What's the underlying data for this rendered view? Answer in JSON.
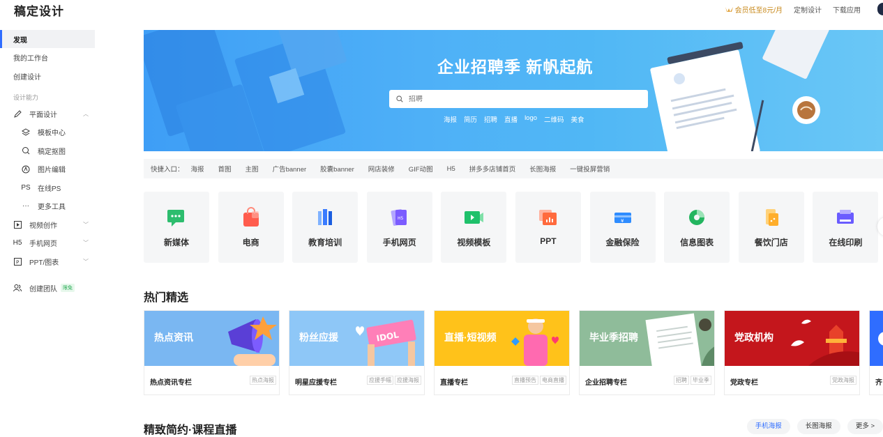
{
  "header": {
    "logo": "稿定设计",
    "vip": "会员低至8元/月",
    "custom_design": "定制设计",
    "download_app": "下载应用"
  },
  "sidebar": {
    "top": [
      {
        "label": "发现",
        "active": true
      },
      {
        "label": "我的工作台"
      },
      {
        "label": "创建设计"
      }
    ],
    "section_label": "设计能力",
    "graphic": "平面设计",
    "graphic_sub": [
      {
        "label": "模板中心",
        "icon": "layers-icon"
      },
      {
        "label": "稿定抠图",
        "icon": "cutout-icon"
      },
      {
        "label": "图片编辑",
        "icon": "image-edit-icon"
      },
      {
        "label": "在线PS",
        "icon": "ps-icon",
        "glyph": "PS"
      },
      {
        "label": "更多工具",
        "icon": "more-icon",
        "glyph": "···"
      }
    ],
    "video": "视频创作",
    "h5": "手机网页",
    "h5_glyph": "H5",
    "ppt": "PPT/图表",
    "team": "创建团队",
    "team_badge": "限免"
  },
  "banner": {
    "title": "企业招聘季 新帆起航",
    "search_placeholder": "招聘",
    "tags": [
      "海报",
      "简历",
      "招聘",
      "直播",
      "logo",
      "二维码",
      "美食"
    ]
  },
  "quick": {
    "label": "快捷入口：",
    "items": [
      "海报",
      "首图",
      "主图",
      "广告banner",
      "胶囊banner",
      "网店装修",
      "GIF动图",
      "H5",
      "拼多多店铺首页",
      "长图海报",
      "一键投屏营销"
    ]
  },
  "categories": [
    {
      "label": "新媒体",
      "color": "#2dbd6e"
    },
    {
      "label": "电商",
      "color": "#ff5c4d"
    },
    {
      "label": "教育培训",
      "color": "#3a7bff"
    },
    {
      "label": "手机网页",
      "color": "#7b5cff"
    },
    {
      "label": "视频模板",
      "color": "#1fc16b"
    },
    {
      "label": "PPT",
      "color": "#ff6a3d"
    },
    {
      "label": "金融保险",
      "color": "#2e8cff"
    },
    {
      "label": "信息图表",
      "color": "#23b55f"
    },
    {
      "label": "餐饮门店",
      "color": "#ffae2b"
    },
    {
      "label": "在线印刷",
      "color": "#6a5cff"
    }
  ],
  "hot": {
    "title": "热门精选",
    "cards": [
      {
        "overlay": "热点资讯",
        "name": "热点资讯专栏",
        "tags": [
          "热点海报"
        ],
        "bg": "#7ab7f2"
      },
      {
        "overlay": "粉丝应援",
        "name": "明星应援专栏",
        "tags": [
          "应援手幅",
          "应援海报"
        ],
        "bg": "#8ec7f7"
      },
      {
        "overlay": "直播·短视频",
        "name": "直播专栏",
        "tags": [
          "直播预告",
          "电商直播"
        ],
        "bg": "#ffc21a"
      },
      {
        "overlay": "毕业季招聘",
        "name": "企业招聘专栏",
        "tags": [
          "招聘",
          "毕业季"
        ],
        "bg": "#8fbc9a"
      },
      {
        "overlay": "党政机构",
        "name": "党政专栏",
        "tags": [
          "党政海报"
        ],
        "bg": "#c4161c"
      },
      {
        "overlay": "",
        "name": "齐",
        "tags": [],
        "bg": "#2f6dff"
      }
    ]
  },
  "resume": {
    "title": "精致简约·课程直播",
    "buttons": [
      "手机海报",
      "长图海报",
      "更多 >"
    ]
  },
  "colors": {
    "accent": "#2f6dff",
    "vip": "#c8891b"
  }
}
